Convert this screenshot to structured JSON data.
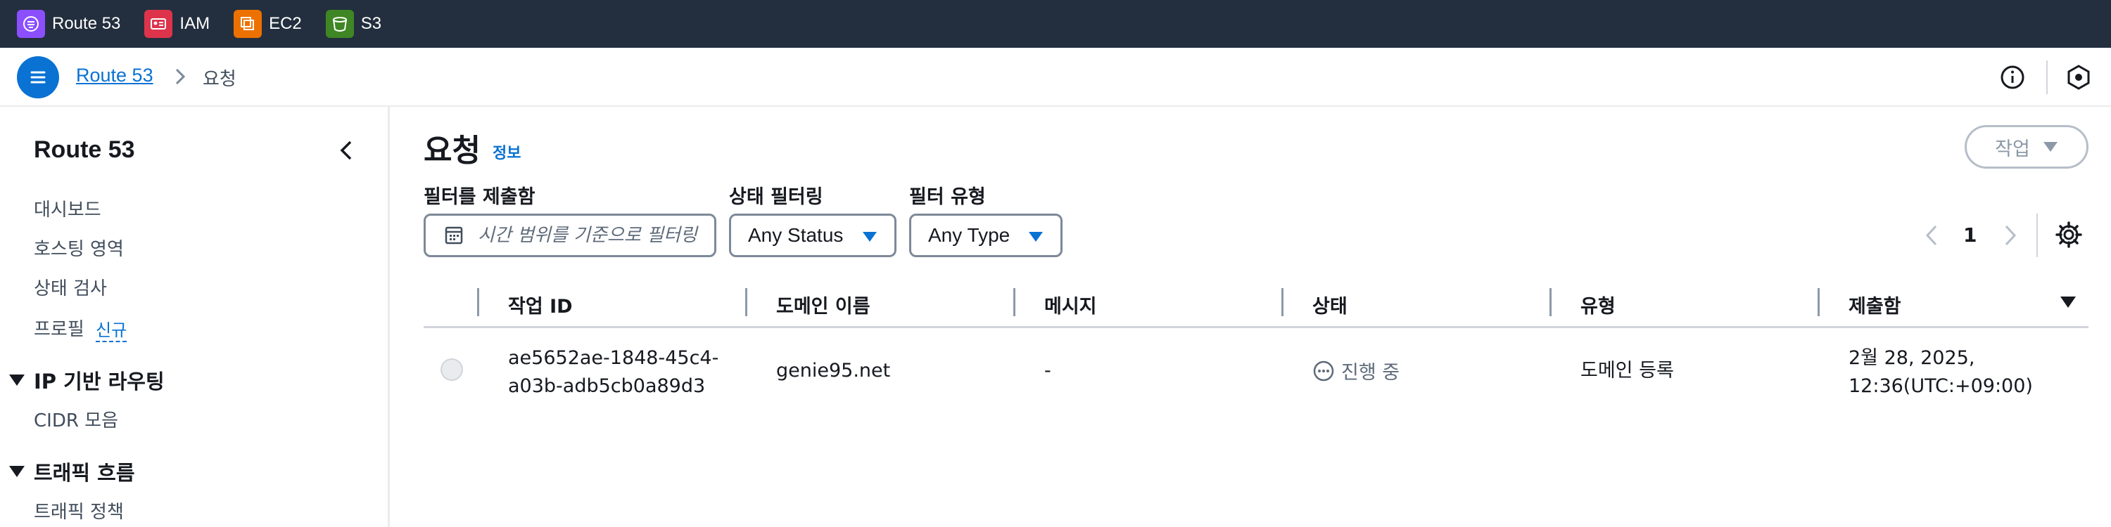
{
  "topbar": {
    "services": [
      {
        "label": "Route 53",
        "icon": "route53-icon",
        "color": "#8c4fff"
      },
      {
        "label": "IAM",
        "icon": "iam-icon",
        "color": "#dd344c"
      },
      {
        "label": "EC2",
        "icon": "ec2-icon",
        "color": "#ed7100"
      },
      {
        "label": "S3",
        "icon": "s3-icon",
        "color": "#3f8624"
      }
    ]
  },
  "breadcrumb": {
    "root": "Route 53",
    "current": "요청"
  },
  "sidebar": {
    "title": "Route 53",
    "items": [
      {
        "label": "대시보드"
      },
      {
        "label": "호스팅 영역"
      },
      {
        "label": "상태 검사"
      },
      {
        "label": "프로필",
        "badge": "신규"
      }
    ],
    "sections": [
      {
        "label": "IP 기반 라우팅",
        "items": [
          {
            "label": "CIDR 모음"
          }
        ]
      },
      {
        "label": "트래픽 흐름",
        "items": [
          {
            "label": "트래픽 정책"
          }
        ]
      }
    ]
  },
  "main": {
    "title": "요청",
    "info_label": "정보",
    "action_label": "작업",
    "filters": {
      "date_label": "필터를 제출함",
      "date_placeholder": "시간 범위를 기준으로 필터링",
      "status_label": "상태 필터링",
      "status_value": "Any Status",
      "type_label": "필터 유형",
      "type_value": "Any Type"
    },
    "pagination": {
      "page": "1"
    },
    "table": {
      "columns": [
        "작업 ID",
        "도메인 이름",
        "메시지",
        "상태",
        "유형",
        "제출함"
      ],
      "rows": [
        {
          "id_line1": "ae5652ae-1848-45c4-",
          "id_line2": "a03b-adb5cb0a89d3",
          "domain": "genie95.net",
          "message": "-",
          "status": "진행 중",
          "type": "도메인 등록",
          "submitted_line1": "2월 28, 2025,",
          "submitted_line2": "12:36(UTC:+09:00)"
        }
      ]
    }
  },
  "colors": {
    "accent": "#0972d3",
    "topbar_bg": "#232f3e"
  }
}
